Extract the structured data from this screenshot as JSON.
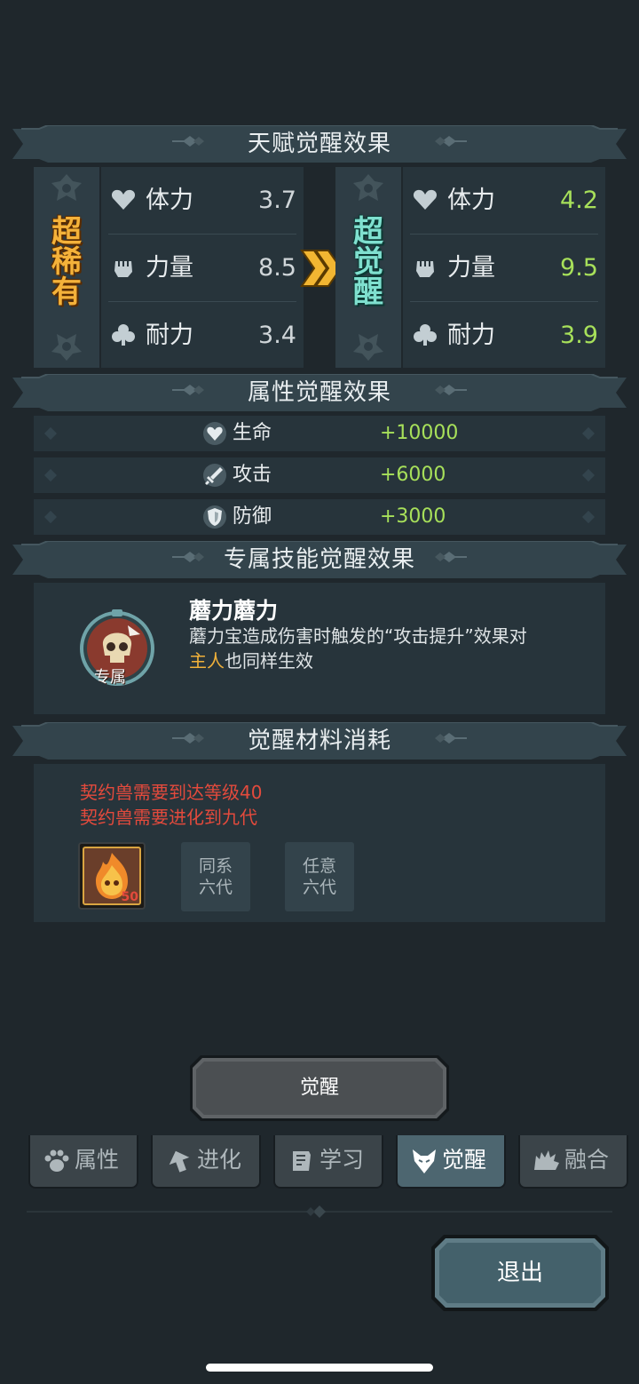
{
  "talent_section": {
    "title": "天赋觉醒效果",
    "before": {
      "rarity": "超稀有",
      "stats": [
        {
          "icon": "heart-icon",
          "label": "体力",
          "value": "3.7"
        },
        {
          "icon": "fist-icon",
          "label": "力量",
          "value": "8.5"
        },
        {
          "icon": "club-icon",
          "label": "耐力",
          "value": "3.4"
        }
      ]
    },
    "after": {
      "rarity": "超觉醒",
      "stats": [
        {
          "icon": "heart-icon",
          "label": "体力",
          "value": "4.2"
        },
        {
          "icon": "fist-icon",
          "label": "力量",
          "value": "9.5"
        },
        {
          "icon": "club-icon",
          "label": "耐力",
          "value": "3.9"
        }
      ]
    }
  },
  "attribute_section": {
    "title": "属性觉醒效果",
    "rows": [
      {
        "icon": "heart-shield-icon",
        "label": "生命",
        "value": "+10000"
      },
      {
        "icon": "sword-icon",
        "label": "攻击",
        "value": "+6000"
      },
      {
        "icon": "shield-icon",
        "label": "防御",
        "value": "+3000"
      }
    ]
  },
  "skill_section": {
    "title": "专属技能觉醒效果",
    "badge": "专属",
    "name": "蘑力蘑力",
    "desc_part1": "蘑力宝造成伤害时触发的“攻击提升”效果对",
    "desc_highlight": "主人",
    "desc_part2": "也同样生效"
  },
  "material_section": {
    "title": "觉醒材料消耗",
    "requirements": [
      "契约兽需要到达等级40",
      "契约兽需要进化到九代"
    ],
    "item_count": "50",
    "slots": [
      {
        "line1": "同系",
        "line2": "六代"
      },
      {
        "line1": "任意",
        "line2": "六代"
      }
    ]
  },
  "awaken_button": "觉醒",
  "tabs": [
    {
      "label": "属性",
      "icon": "paw-icon",
      "active": false
    },
    {
      "label": "进化",
      "icon": "arrow-up-icon",
      "active": false
    },
    {
      "label": "学习",
      "icon": "book-icon",
      "active": false
    },
    {
      "label": "觉醒",
      "icon": "wolf-icon",
      "active": true
    },
    {
      "label": "融合",
      "icon": "beast-icon",
      "active": false
    }
  ],
  "exit_button": "退出",
  "colors": {
    "background": "#1f272c",
    "panel": "#27343b",
    "green": "#a7e05a",
    "orange": "#f0b13a",
    "red": "#e34a3c",
    "active_tab": "#4d6670"
  }
}
